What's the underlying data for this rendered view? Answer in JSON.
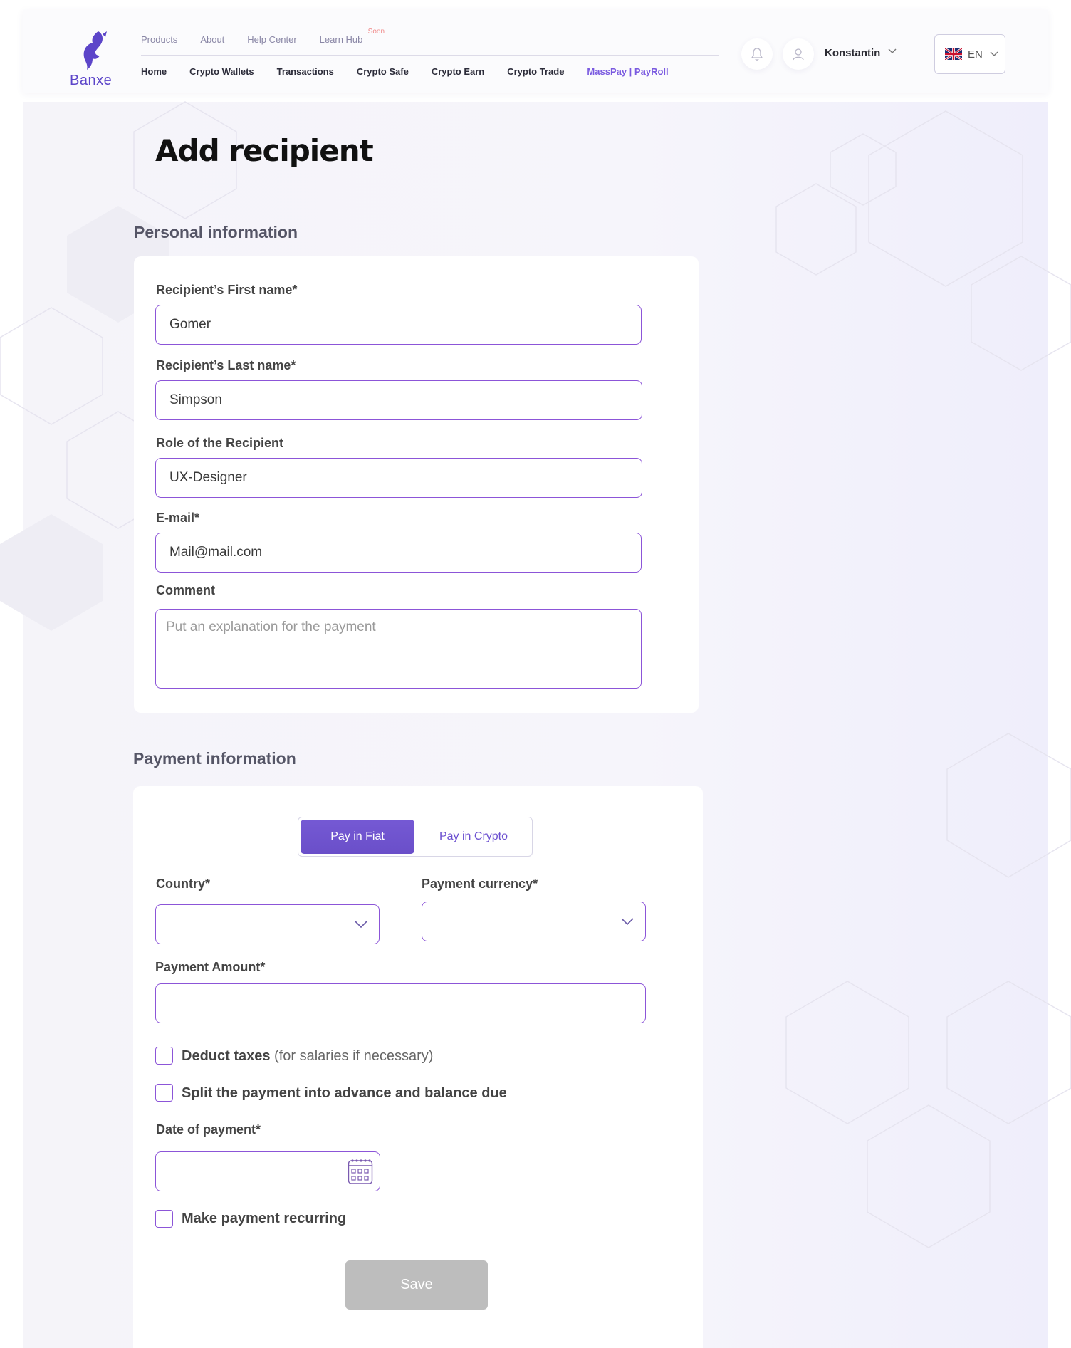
{
  "brand": {
    "name": "Banxe",
    "accent": "#6a4fc9",
    "input_border": "#8c55d8"
  },
  "header": {
    "top_links": [
      {
        "label": "Products"
      },
      {
        "label": "About"
      },
      {
        "label": "Help Center"
      },
      {
        "label": "Learn Hub",
        "badge": "Soon"
      }
    ],
    "main_nav": [
      {
        "label": "Home"
      },
      {
        "label": "Crypto Wallets"
      },
      {
        "label": "Transactions"
      },
      {
        "label": "Crypto Safe"
      },
      {
        "label": "Crypto Earn"
      },
      {
        "label": "Crypto Trade"
      },
      {
        "label": "MassPay | PayRoll",
        "active": true
      }
    ],
    "user": {
      "name": "Konstantin"
    },
    "language": {
      "code": "EN",
      "flag_icon": "uk-flag-icon"
    }
  },
  "page": {
    "title": "Add recipient"
  },
  "personal": {
    "section_title": "Personal information",
    "first_name": {
      "label": "Recipient’s First name*",
      "value": "Gomer"
    },
    "last_name": {
      "label": "Recipient’s Last name*",
      "value": "Simpson"
    },
    "role": {
      "label": "Role of the Recipient",
      "value": "UX-Designer"
    },
    "email": {
      "label": "E-mail*",
      "value": "Mail@mail.com"
    },
    "comment": {
      "label": "Comment",
      "placeholder": "Put an explanation for the payment"
    }
  },
  "payment": {
    "section_title": "Payment information",
    "toggle": {
      "fiat": "Pay in Fiat",
      "crypto": "Pay in Crypto",
      "selected": "fiat"
    },
    "country": {
      "label": "Country*",
      "value": ""
    },
    "currency": {
      "label": "Payment currency*",
      "value": ""
    },
    "amount": {
      "label": "Payment Amount*",
      "value": ""
    },
    "deduct_taxes": {
      "label_bold": "Deduct taxes",
      "label_light": " (for salaries if necessary)",
      "checked": false
    },
    "split_payment": {
      "label": "Split the payment into advance and balance due",
      "checked": false
    },
    "date": {
      "label": "Date of payment*",
      "value": ""
    },
    "recurring": {
      "label": "Make payment recurring",
      "checked": false
    },
    "save_label": "Save"
  }
}
